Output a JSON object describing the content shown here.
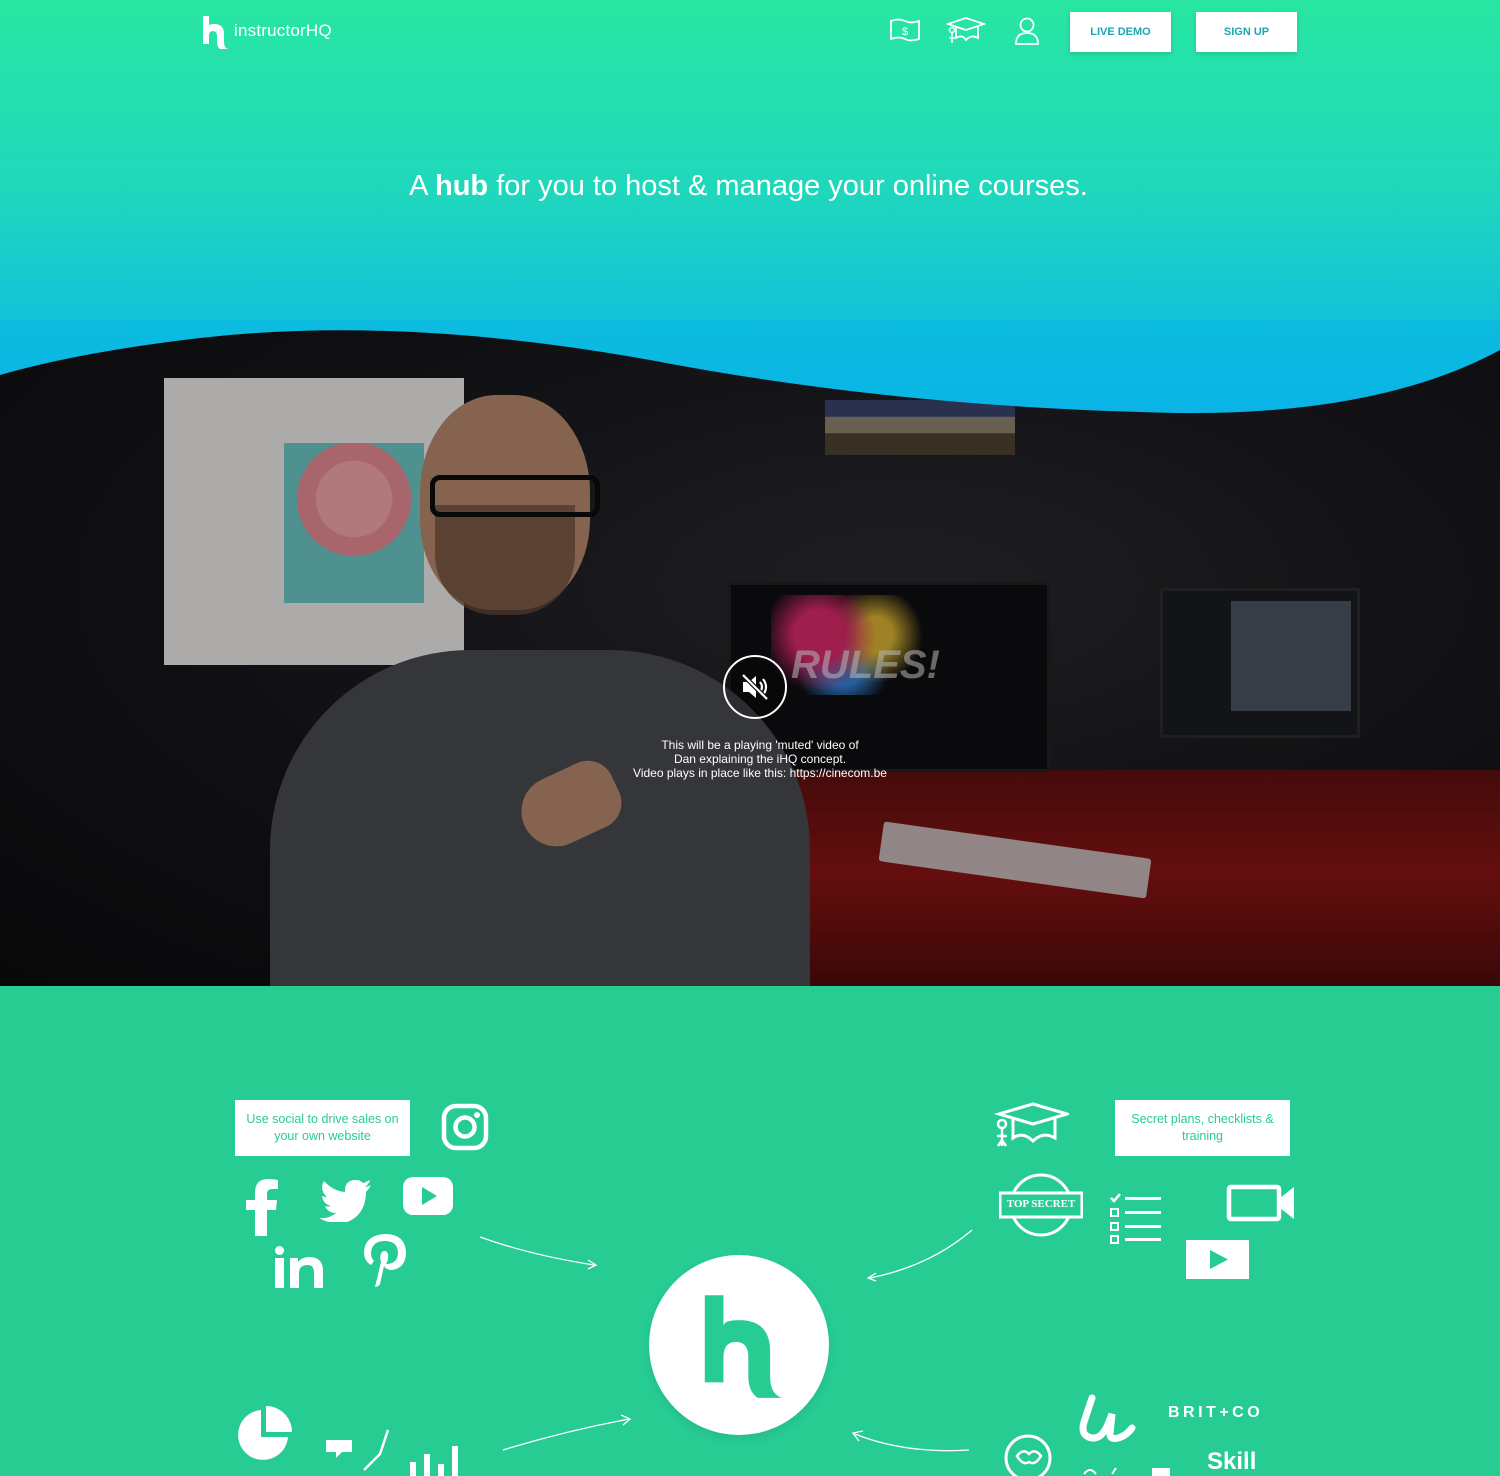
{
  "header": {
    "logo_text": "instructorHQ",
    "nav_icons": [
      "pricing-icon",
      "courses-icon",
      "account-icon"
    ],
    "live_demo_label": "LIVE DEMO",
    "sign_up_label": "SIGN UP"
  },
  "hero": {
    "headline_prefix": "A ",
    "headline_bold": "hub",
    "headline_suffix": " for you to host & manage your online courses."
  },
  "video": {
    "screen_text": "RULES!",
    "caption_line1": "This will be a playing 'muted' video of",
    "caption_line2": "Dan explaining the iHQ concept.",
    "caption_line3_prefix": "Video plays in place like this: ",
    "caption_link": "https://cinecom.be"
  },
  "features": {
    "social_label": "Use social to drive sales on your own website",
    "training_label": "Secret plans, checklists & training",
    "top_secret_text": "TOP SECRET",
    "brit_co_text": "BRIT+CO",
    "skill_text": "Skill"
  },
  "colors": {
    "brand_green": "#27cc93",
    "hero_top": "#28e6a2",
    "hero_bottom": "#0ab4e6",
    "button_text": "#1aa6b5"
  }
}
